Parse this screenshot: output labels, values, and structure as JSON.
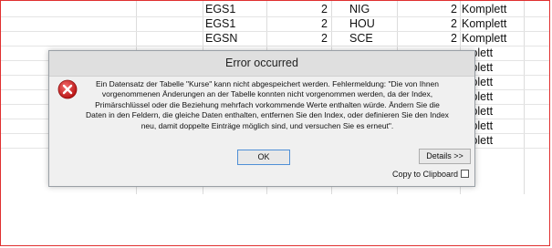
{
  "table": {
    "rows": [
      [
        "EGS1",
        "2",
        "NIG",
        "2",
        "Komplett"
      ],
      [
        "EGS1",
        "2",
        "HOU",
        "2",
        "Komplett"
      ],
      [
        "EGSN",
        "2",
        "SCE",
        "2",
        "Komplett"
      ],
      [
        "",
        "",
        "",
        "",
        "mplett"
      ],
      [
        "",
        "",
        "",
        "",
        "mplett"
      ],
      [
        "",
        "",
        "",
        "",
        "mplett"
      ],
      [
        "",
        "",
        "",
        "",
        "mplett"
      ],
      [
        "",
        "",
        "",
        "",
        "mplett"
      ],
      [
        "",
        "",
        "",
        "",
        "mplett"
      ],
      [
        "",
        "",
        "",
        "",
        "mplett"
      ]
    ]
  },
  "dialog": {
    "title": "Error occurred",
    "icon": "error-icon",
    "message": "Ein Datensatz der Tabelle \"Kurse\" kann nicht abgespeichert werden. Fehlermeldung: \"Die von Ihnen vorgenommenen Änderungen an der Tabelle konnten nicht vorgenommen werden, da der Index, Primärschlüssel oder die Beziehung mehrfach vorkommende Werte enthalten würde. Ändern Sie die Daten in den Feldern, die gleiche Daten enthalten, entfernen Sie den Index, oder definieren Sie den Index neu, damit doppelte Einträge möglich sind, und versuchen Sie es erneut\".",
    "ok_label": "OK",
    "details_label": "Details >>",
    "copy_label": "Copy to Clipboard",
    "copy_checked": false
  },
  "colors": {
    "frame_border": "#e03030",
    "dialog_bg": "#f0f0f0",
    "error_red": "#d42a2a"
  }
}
